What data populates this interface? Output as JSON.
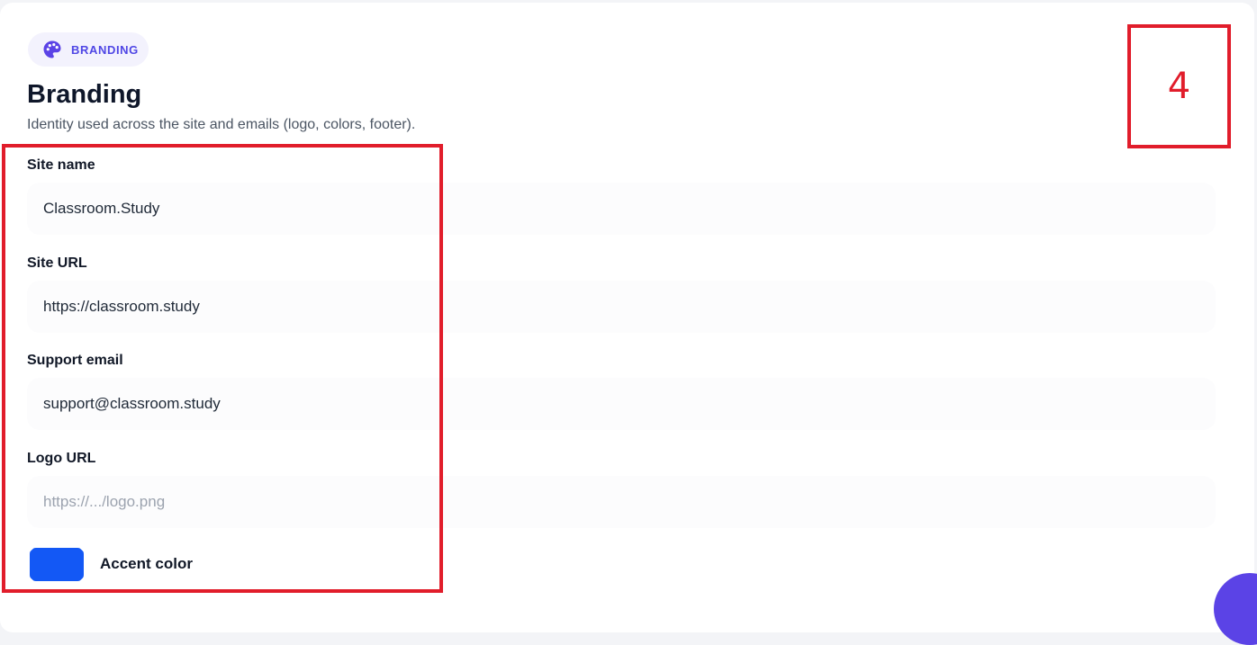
{
  "section": {
    "badge": "BRANDING",
    "badge_icon": "palette-icon",
    "title": "Branding",
    "subtitle": "Identity used across the site and emails (logo, colors, footer)."
  },
  "fields": {
    "site_name": {
      "label": "Site name",
      "value": "Classroom.Study"
    },
    "site_url": {
      "label": "Site URL",
      "value": "https://classroom.study"
    },
    "support_email": {
      "label": "Support email",
      "value": "support@classroom.study"
    },
    "logo_url": {
      "label": "Logo URL",
      "value": "",
      "placeholder": "https://.../logo.png"
    }
  },
  "accent": {
    "label": "Accent color",
    "color": "#1358f5"
  },
  "annotation": {
    "number": "4",
    "color": "#e11d2b"
  },
  "colors": {
    "brand": "#4f46e5",
    "badge_bg": "#f3f2fd"
  },
  "chat": {
    "icon": "chat-icon"
  }
}
